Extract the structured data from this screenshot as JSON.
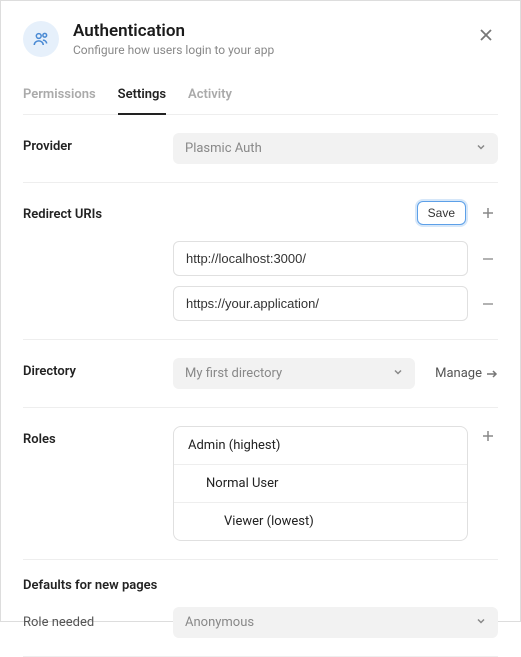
{
  "header": {
    "title": "Authentication",
    "subtitle": "Configure how users login to your app"
  },
  "tabs": {
    "items": [
      {
        "label": "Permissions"
      },
      {
        "label": "Settings"
      },
      {
        "label": "Activity"
      }
    ]
  },
  "provider": {
    "label": "Provider",
    "value": "Plasmic Auth"
  },
  "redirect": {
    "label": "Redirect URIs",
    "save_label": "Save",
    "uris": [
      "http://localhost:3000/",
      "https://your.application/"
    ]
  },
  "directory": {
    "label": "Directory",
    "value": "My first directory",
    "manage_label": "Manage"
  },
  "roles": {
    "label": "Roles",
    "items": [
      {
        "label": "Admin (highest)"
      },
      {
        "label": "Normal User"
      },
      {
        "label": "Viewer (lowest)"
      }
    ]
  },
  "defaults": {
    "header": "Defaults for new pages",
    "role_needed_label": "Role needed",
    "role_needed_value": "Anonymous"
  }
}
